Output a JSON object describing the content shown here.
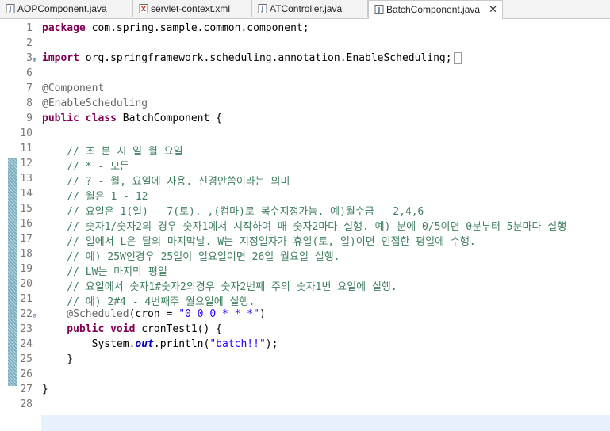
{
  "tabs": [
    {
      "label": "AOPComponent.java",
      "icon": "java-file-icon"
    },
    {
      "label": "servlet-context.xml",
      "icon": "xml-file-icon"
    },
    {
      "label": "ATController.java",
      "icon": "java-file-icon"
    },
    {
      "label": "BatchComponent.java",
      "icon": "java-file-icon",
      "active": true,
      "close": "✕"
    }
  ],
  "gutter": [
    "1",
    "2",
    "3",
    "6",
    "7",
    "8",
    "9",
    "10",
    "11",
    "12",
    "13",
    "14",
    "15",
    "16",
    "17",
    "18",
    "19",
    "20",
    "21",
    "22",
    "23",
    "24",
    "25",
    "26",
    "27",
    "28"
  ],
  "code": {
    "l1": {
      "kw": "package",
      "rest": " com.spring.sample.common.component;"
    },
    "l3": {
      "kw": "import",
      "rest": " org.springframework.scheduling.annotation.EnableScheduling;"
    },
    "l7": "@Component",
    "l8": "@EnableScheduling",
    "l9": {
      "kw": "public class",
      "rest": " BatchComponent {"
    },
    "comments": [
      "    // 초 분 시 일 월 요일",
      "    // * - 모든",
      "    // ? - 월, 요일에 사용. 신경안씀이라는 의미",
      "    // 월은 1 - 12",
      "    // 요일은 1(일) - 7(토). ,(컴마)로 복수지정가능. 예)월수금 - 2,4,6",
      "    // 숫자1/숫자2의 경우 숫자1에서 시작하여 매 숫자2마다 실행. 예) 분에 0/5이면 0분부터 5분마다 실행",
      "    // 일에서 L은 달의 마지막날. W는 지정일자가 휴일(토, 일)이면 인접한 평일에 수행.",
      "    // 예) 25W인경우 25일이 일요일이면 26일 월요일 실행.",
      "    // LW는 마지막 평일",
      "    // 요일에서 숫자1#숫자2의경우 숫자2번째 주의 숫자1번 요일에 실행.",
      "    // 예) 2#4 - 4번째주 월요일에 실행."
    ],
    "l22": {
      "ann": "    @Scheduled",
      "mid": "(cron = ",
      "str": "\"0 0 0 * * *\"",
      "end": ")"
    },
    "l23": {
      "kw": "    public void",
      "rest": " cronTest1() {"
    },
    "l24": {
      "pre": "        System.",
      "field": "out",
      "mid": ".println(",
      "str": "\"batch!!\"",
      "end": ");"
    },
    "l25": "    }",
    "l27": "}"
  }
}
